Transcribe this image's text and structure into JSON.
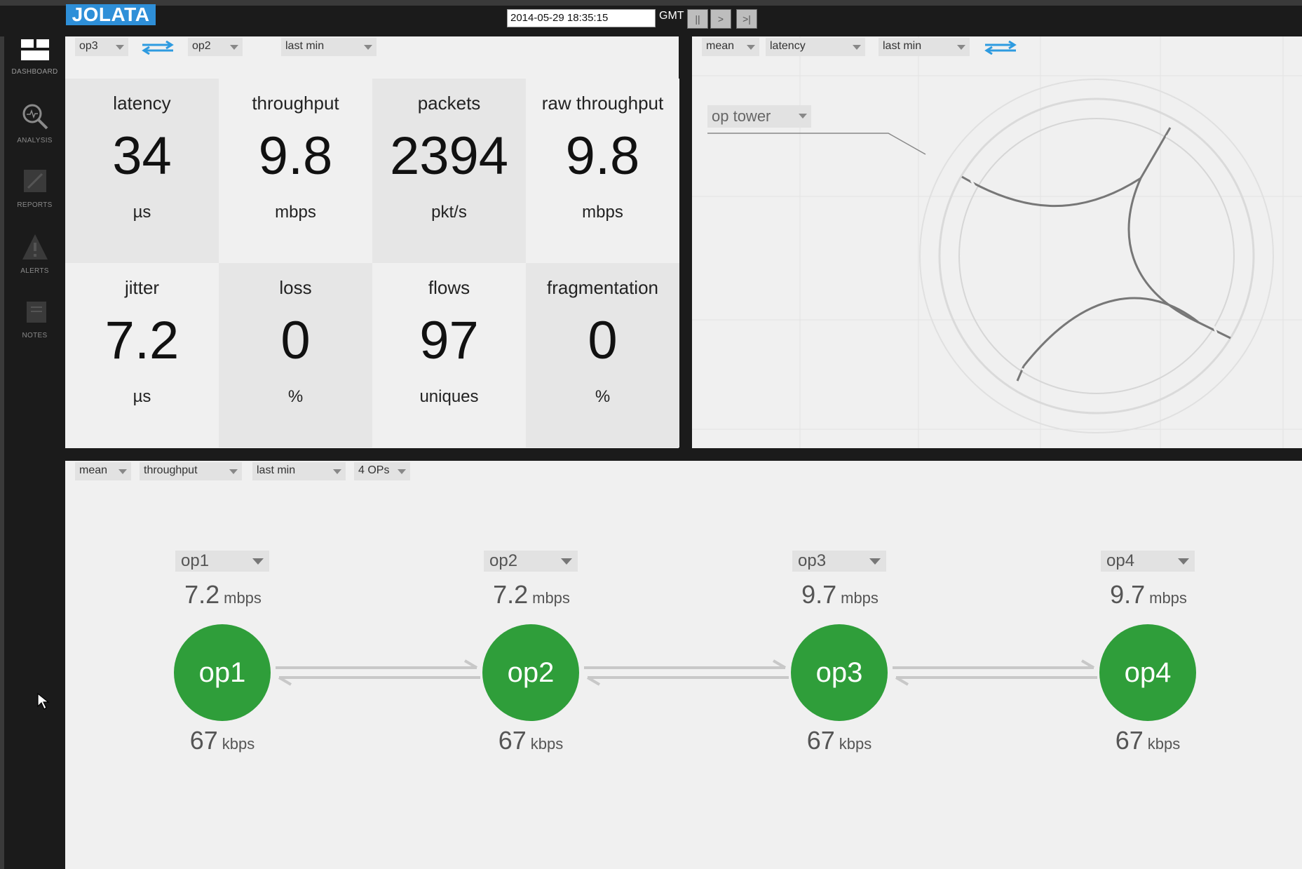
{
  "app": {
    "logo": "JOLATA"
  },
  "topbar": {
    "datetime": "2014-05-29 18:35:15",
    "timezone": "GMT",
    "pause": "||",
    "step": ">",
    "end": ">|"
  },
  "sidebar": {
    "items": [
      {
        "label": "DASHBOARD",
        "icon": "dashboard-icon"
      },
      {
        "label": "ANALYSIS",
        "icon": "magnifier-icon"
      },
      {
        "label": "REPORTS",
        "icon": "reports-icon"
      },
      {
        "label": "ALERTS",
        "icon": "alert-icon"
      },
      {
        "label": "NOTES",
        "icon": "notes-icon"
      }
    ]
  },
  "metrics_panel": {
    "source": "op3",
    "target": "op2",
    "window": "last min",
    "tiles": [
      {
        "label": "latency",
        "value": "34",
        "unit": "µs"
      },
      {
        "label": "throughput",
        "value": "9.8",
        "unit": "mbps"
      },
      {
        "label": "packets",
        "value": "2394",
        "unit": "pkt/s"
      },
      {
        "label": "raw throughput",
        "value": "9.8",
        "unit": "mbps"
      },
      {
        "label": "jitter",
        "value": "7.2",
        "unit": "µs"
      },
      {
        "label": "loss",
        "value": "0",
        "unit": "%"
      },
      {
        "label": "flows",
        "value": "97",
        "unit": "uniques"
      },
      {
        "label": "fragmentation",
        "value": "0",
        "unit": "%"
      }
    ]
  },
  "tower_panel": {
    "aggregate": "mean",
    "metric": "latency",
    "window": "last min",
    "tower_select": "op tower"
  },
  "flow_panel": {
    "aggregate": "mean",
    "metric": "throughput",
    "window": "last min",
    "ops_count": "4 OPs",
    "nodes": [
      {
        "select": "op1",
        "name": "op1",
        "top_value": "7.2",
        "top_unit": "mbps",
        "bottom_value": "67",
        "bottom_unit": "kbps"
      },
      {
        "select": "op2",
        "name": "op2",
        "top_value": "7.2",
        "top_unit": "mbps",
        "bottom_value": "67",
        "bottom_unit": "kbps"
      },
      {
        "select": "op3",
        "name": "op3",
        "top_value": "9.7",
        "top_unit": "mbps",
        "bottom_value": "67",
        "bottom_unit": "kbps"
      },
      {
        "select": "op4",
        "name": "op4",
        "top_value": "9.7",
        "top_unit": "mbps",
        "bottom_value": "67",
        "bottom_unit": "kbps"
      }
    ]
  },
  "colors": {
    "accent": "#2e8fd8",
    "node_green": "#2f9e3a",
    "panel_bg": "#f0f0f0",
    "tile_dark": "#e6e6e6"
  }
}
